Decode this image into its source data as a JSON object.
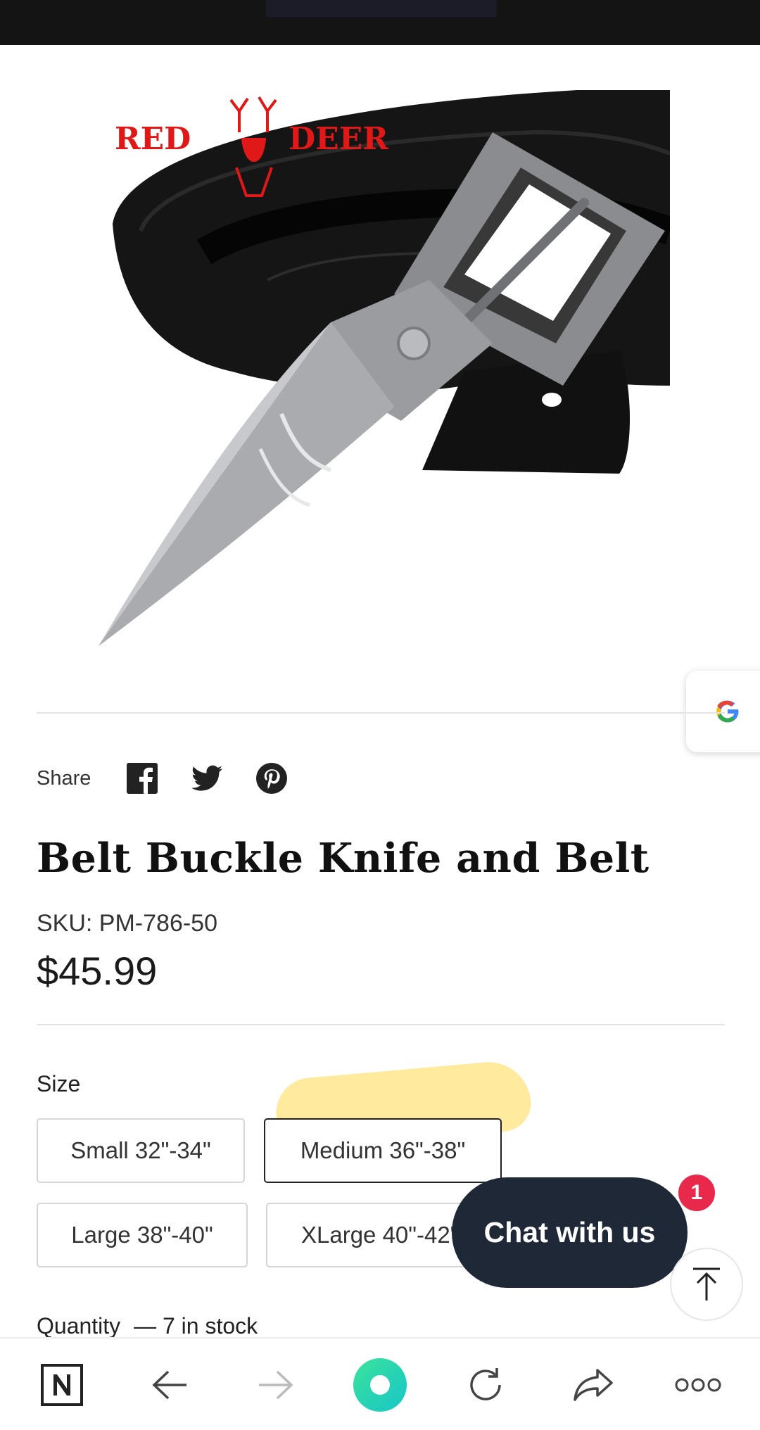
{
  "product": {
    "brand_logo_text": "RED DEER",
    "title": "Belt Buckle Knife and Belt",
    "sku": "SKU: PM-786-50",
    "price": "$45.99"
  },
  "share": {
    "label": "Share",
    "icons": [
      "facebook-icon",
      "twitter-icon",
      "pinterest-icon"
    ]
  },
  "size": {
    "label": "Size",
    "options": [
      "Small 32\"-34\"",
      "Medium 36\"-38\"",
      "Large 38\"-40\"",
      "XLarge 40\"-42\""
    ],
    "selected": "Medium 36\"-38\""
  },
  "quantity": {
    "label": "Quantity",
    "stock": "— 7 in stock"
  },
  "chat": {
    "label": "Chat with us",
    "badge_count": "1"
  },
  "google_badge": {
    "letter": "G"
  },
  "browser_nav": {
    "icons": [
      "n-logo-icon",
      "back-arrow-icon",
      "forward-arrow-icon",
      "home-circle-icon",
      "refresh-icon",
      "share-icon",
      "more-dots-icon"
    ]
  },
  "colors": {
    "chat_bg": "#1f2837",
    "badge_red": "#e8294c",
    "highlight_yellow": "#ffd63c",
    "brand_red": "#e01818"
  }
}
